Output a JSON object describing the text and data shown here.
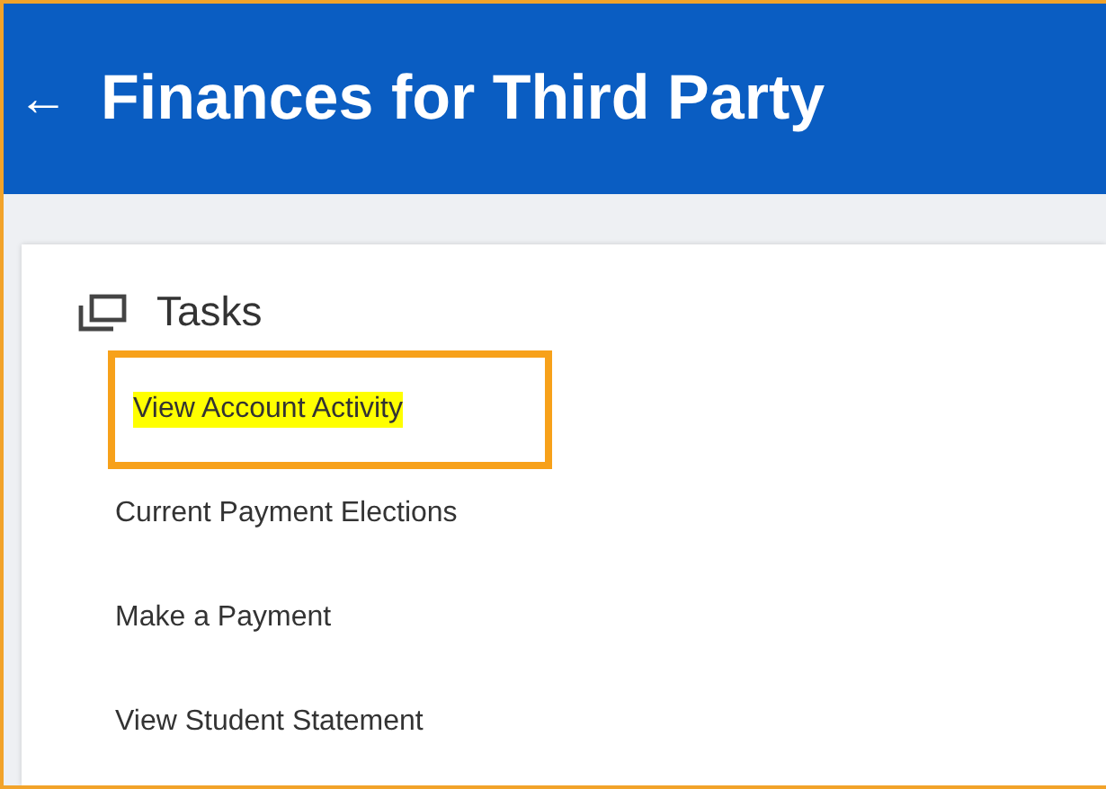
{
  "header": {
    "back": "←",
    "title": "Finances for Third Party"
  },
  "section": {
    "title": "Tasks"
  },
  "tasks": [
    {
      "label": "View Account Activity",
      "highlighted": true,
      "framed": true
    },
    {
      "label": "Current Payment Elections",
      "highlighted": false,
      "framed": false
    },
    {
      "label": "Make a Payment",
      "highlighted": false,
      "framed": false
    },
    {
      "label": "View Student Statement",
      "highlighted": false,
      "framed": false
    }
  ]
}
